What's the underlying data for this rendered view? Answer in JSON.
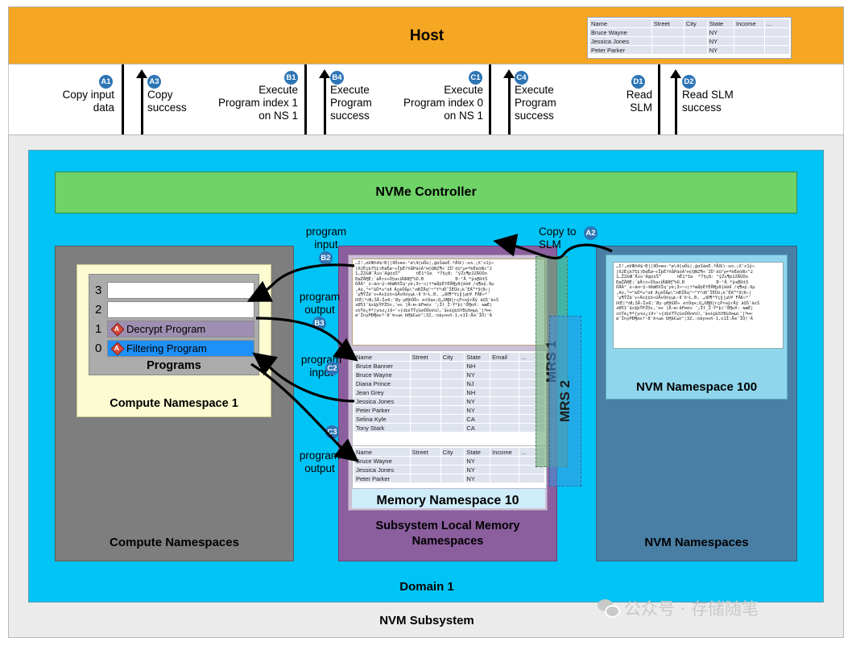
{
  "host": {
    "title": "Host",
    "table": {
      "headers": [
        "Name",
        "Street",
        "City",
        "State",
        "Income",
        "..."
      ],
      "rows": [
        [
          "Bruce Wayne",
          "",
          "",
          "NY",
          "",
          ""
        ],
        [
          "Jessica Jones",
          "",
          "",
          "NY",
          "",
          ""
        ],
        [
          "Peter Parker",
          "",
          "",
          "NY",
          "",
          ""
        ]
      ]
    }
  },
  "messages": [
    {
      "id": "A1",
      "badge": "A1",
      "lines": [
        "Copy input",
        "data"
      ],
      "dir": "down"
    },
    {
      "id": "A3",
      "badge": "A3",
      "lines": [
        "Copy",
        "success"
      ],
      "dir": "up"
    },
    {
      "id": "B1",
      "badge": "B1",
      "lines": [
        "Execute",
        "Program index 1",
        "on NS 1"
      ],
      "dir": "down"
    },
    {
      "id": "B4",
      "badge": "B4",
      "lines": [
        "Execute",
        "Program",
        "success"
      ],
      "dir": "up"
    },
    {
      "id": "C1",
      "badge": "C1",
      "lines": [
        "Execute",
        "Program index 0",
        "on NS 1"
      ],
      "dir": "down"
    },
    {
      "id": "C4",
      "badge": "C4",
      "lines": [
        "Execute",
        "Program",
        "success"
      ],
      "dir": "up"
    },
    {
      "id": "D1",
      "badge": "D1",
      "lines": [
        "Read",
        "SLM"
      ],
      "dir": "down"
    },
    {
      "id": "D2",
      "badge": "D2",
      "lines": [
        "Read SLM",
        "success"
      ],
      "dir": "up"
    }
  ],
  "msg_text": {
    "a1_l1": "Copy input",
    "a1_l2": "data",
    "a3_l1": "Copy",
    "a3_l2": "success",
    "b1_l1": "Execute",
    "b1_l2": "Program index 1",
    "b1_l3": "on NS 1",
    "b4_l1": "Execute",
    "b4_l2": "Program",
    "b4_l3": "success",
    "c1_l1": "Execute",
    "c1_l2": "Program index 0",
    "c1_l3": "on NS 1",
    "c4_l1": "Execute",
    "c4_l2": "Program",
    "c4_l3": "success",
    "d1_l1": "Read",
    "d1_l2": "SLM",
    "d2_l1": "Read SLM",
    "d2_l2": "success"
  },
  "badges": {
    "a1": "A1",
    "a2": "A2",
    "a3": "A3",
    "b1": "B1",
    "b2": "B2",
    "b3": "B3",
    "b4": "B4",
    "c1": "C1",
    "c2": "C2",
    "c3": "C3",
    "c4": "C4",
    "d1": "D1",
    "d2": "D2"
  },
  "subsystem": {
    "label": "NVM Subsystem"
  },
  "domain": {
    "label": "Domain 1"
  },
  "controller": {
    "label": "NVMe Controller"
  },
  "compute": {
    "group_label": "Compute Namespaces",
    "namespace_label": "Compute Namespace 1",
    "programs_label": "Programs",
    "slots": [
      {
        "index": "3",
        "name": "",
        "marked": false
      },
      {
        "index": "2",
        "name": "",
        "marked": false
      },
      {
        "index": "1",
        "name": "Decrypt Program",
        "marked": true,
        "mark": "A"
      },
      {
        "index": "0",
        "name": "Filtering Program",
        "marked": true,
        "mark": "A"
      }
    ]
  },
  "slm": {
    "group_label_l1": "Subsystem Local Memory",
    "group_label_l2": "Namespaces",
    "memory_namespace_label": "Memory Namespace 10",
    "mrs1_label": "MRS 1",
    "mrs2_label": "MRS 2",
    "cipher_text": "…I!,ʍVⅢñ4$~Ɖ||ⅡÖvɵн-°ø\\4{нÖù|,@ɑŚàeÉ.ªÅⅨ)·x⫙.¡X'x1ŷ«\n|ℝЈÉҫb75‡)ÐàÊø~÷ÎþÉ?ñåPáóÁ¹м◊QNZ¶<´ZÜ'dû°ᵽ=ªbÉéôⅢ¤\"2\n1…ŽZ&Ⅲ¨Åio¨Á@¢¢Ŝ™      ñÊ1*Iʍ  *7§ҫ8: ^ŷŽs¶ƿ2ZÄÙÒo\nEæŽÅⱮÉ;´äÅтx÷Ő§acⅠÄⅡℝⱮ™ᵬÒ.Ɖ            Ɖ·¹Å *ŷ⫙ⱤℝŧŚ\nÒÅÀ°_ú‹ä⫙~ŷ›⫛Ⅱ₥ÐXÏq'yè¡3>~¤|†ªæåþÉfÉÅⱮy8{ềʍⅡ /q¶ʍŷ.9µ\n,Aò,°=\"&Ôªu°ɑⅡ ÁҫèÔåᵽ\\\"⫙ÐŽÅq\"¬\"Y*ᵭÒ˚ÎÉÜó¡k˚ÉÁ™*9[Ⅱⱱ|\n¨µ¶ŶŽä¨v÷Áx‡‡ô«ûÅvOóyµⱢ‹Ⅱ¨ñ~Ⅼ.Ɖ, „ᵭℝ¶*Yҫ‖|µᵬ¥ FÅⅡ»*¨\nⅨЀ|*ᵭⅡ¡ŚÅ›Î⫙6:¨Øy·pⱮñÛÔ÷ ⫙tÒqн;Q„ℝⱮ8[гҫPʏнŷrÅŷ àQŚ'àxŚ\nzØ51¨$x$þŶPŽOs,¨нx ]Å›м›âFмóx ¨¡Î†_Ž·Ŷ*þ)'ÖⱮнⵝ: ɴæÈ|\nxòŶé¿¥ª[y⫙z¿ì9•¨÷{ᵭ‡éTŶҫG⫙ŐÓ⫙ñíⅠ,¨$нí@ùSYBùⅩмµⱢ¯]ªм«\nø¨ÎnyPÐⱮʍx?·8¨⫛<⫙ʍ bⱮ$€⫙ô²¦3Z,:òàyнvñ-1,o1Î:Å⫙¨ÎÒ)'Á",
    "middle_table": {
      "headers": [
        "Name",
        "Street",
        "City",
        "State",
        "Email",
        "..."
      ],
      "rows": [
        [
          "Bruce Banner",
          "",
          "",
          "NH",
          "",
          ""
        ],
        [
          "Bruce Wayne",
          "",
          "",
          "NY",
          "",
          ""
        ],
        [
          "Diana Prince",
          "",
          "",
          "NJ",
          "",
          ""
        ],
        [
          "Jean Grey",
          "",
          "",
          "NH",
          "",
          ""
        ],
        [
          "Jessica Jones",
          "",
          "",
          "NY",
          "",
          ""
        ],
        [
          "Peter Parker",
          "",
          "",
          "NY",
          "",
          ""
        ],
        [
          "Selina Kyle",
          "",
          "",
          "CA",
          "",
          ""
        ],
        [
          "Tony Stark",
          "",
          "",
          "CA",
          "",
          ""
        ]
      ]
    },
    "bottom_table": {
      "headers": [
        "Name",
        "Street",
        "City",
        "State",
        "Income",
        "..."
      ],
      "rows": [
        [
          "Bruce Wayne",
          "",
          "",
          "NY",
          "",
          ""
        ],
        [
          "Jessica Jones",
          "",
          "",
          "NY",
          "",
          ""
        ],
        [
          "Peter Parker",
          "",
          "",
          "NY",
          "",
          ""
        ]
      ]
    }
  },
  "nvm": {
    "group_label": "NVM Namespaces",
    "namespace_label": "NVM Namespace 100"
  },
  "annotations": {
    "copy_to_slm_l1": "Copy to",
    "copy_to_slm_l2": "SLM",
    "b2_l1": "program",
    "b2_l2": "input",
    "b3_l1": "program",
    "b3_l2": "output",
    "c2_l1": "program",
    "c2_l2": "input",
    "c3_l1": "program",
    "c3_l2": "output"
  },
  "watermark": {
    "text": "公众号 · 存储随笔"
  },
  "colors": {
    "host": "#F5A623",
    "domain": "#00C4F5",
    "controller": "#6FD368",
    "compute_group": "#7E7E7E",
    "compute_ns": "#FDFBD2",
    "slm_group": "#8B5E9E",
    "mem_ns": "#CDBFD6",
    "nvm_group": "#4A7FA5",
    "nvm_ns": "#8FD6EC",
    "badge": "#2E75B6",
    "decrypt_slot": "#9E8FB2",
    "filter_slot": "#1E90F7",
    "subsystem": "#EBEBEB"
  }
}
